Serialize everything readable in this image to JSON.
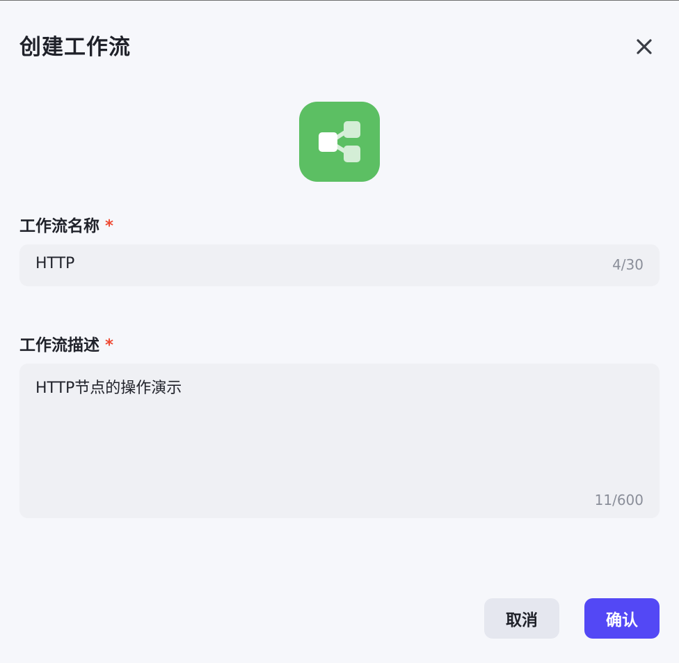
{
  "dialog": {
    "title": "创建工作流",
    "close_icon": "close-icon"
  },
  "app_icon": {
    "icon": "workflow-share-icon",
    "background": "#5cbf63"
  },
  "name_field": {
    "label": "工作流名称",
    "required_mark": "*",
    "value": "HTTP",
    "counter": "4/30"
  },
  "desc_field": {
    "label": "工作流描述",
    "required_mark": "*",
    "value": "HTTP节点的操作演示",
    "counter": "11/600"
  },
  "footer": {
    "cancel_label": "取消",
    "confirm_label": "确认"
  },
  "colors": {
    "primary": "#5348f5",
    "required": "#ee4a34",
    "input_bg": "#eff0f4"
  }
}
